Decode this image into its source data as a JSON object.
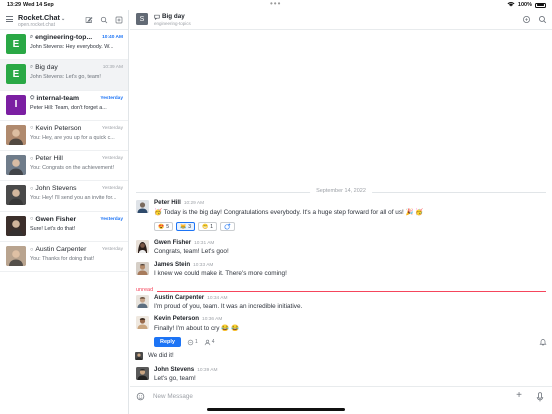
{
  "status_bar": {
    "time": "13:29",
    "date": "Wed 14 Sep",
    "battery": "100%"
  },
  "sidebar": {
    "workspace": "Rocket.Chat",
    "server": "open.rocket.chat",
    "rooms": [
      {
        "name": "engineering-top...",
        "time": "10:40 AM",
        "preview": "John Stevens: Hey everybody. W...",
        "avatar_letter": "E",
        "avatar_color": "#2aa845",
        "icon": "discussion-icon",
        "unread": true,
        "active": false
      },
      {
        "name": "Big day",
        "time": "10:39 AM",
        "preview": "John Stevens: Let's go, team!",
        "avatar_letter": "E",
        "avatar_color": "#2aa845",
        "icon": "discussion-icon",
        "unread": false,
        "active": true
      },
      {
        "name": "internal-team",
        "time": "Yesterday",
        "preview": "Peter Hill: Team, don't forget a...",
        "avatar_letter": "I",
        "avatar_color": "#7b1fa2",
        "icon": "team-icon",
        "unread": true,
        "active": false
      },
      {
        "name": "Kevin Peterson",
        "time": "Yesterday",
        "preview": "You: Hey, are you up for a quick c...",
        "avatar_color": "#b08a6e",
        "icon": "status-icon",
        "unread": false,
        "active": false
      },
      {
        "name": "Peter Hill",
        "time": "Yesterday",
        "preview": "You: Congrats on the achievement!",
        "avatar_color": "#6f7c8a",
        "icon": "status-icon",
        "unread": false,
        "active": false
      },
      {
        "name": "John Stevens",
        "time": "Yesterday",
        "preview": "You: Hey! I'll send you an invite for...",
        "avatar_color": "#4a4a4a",
        "icon": "status-icon",
        "unread": false,
        "active": false
      },
      {
        "name": "Gwen Fisher",
        "time": "Yesterday",
        "preview": "Sure! Let's do that!",
        "avatar_color": "#3c2f2b",
        "icon": "status-icon",
        "unread": true,
        "active": false
      },
      {
        "name": "Austin Carpenter",
        "time": "Yesterday",
        "preview": "You: Thanks for doing that!",
        "avatar_color": "#b9a48f",
        "icon": "status-icon",
        "unread": false,
        "active": false
      }
    ]
  },
  "header": {
    "title": "Big day",
    "subtitle": "engineering-topics",
    "avatar_letter": "S"
  },
  "messages": {
    "day_separator": "September 14, 2022",
    "unread_label": "unread",
    "items": [
      {
        "author": "Peter Hill",
        "time": "10:29 AM",
        "text": "🥳 Today is the big day! Congratulations everybody. It's a huge step forward for all of us! 🎉 🥳",
        "avatar_color": "#6f7c8a"
      },
      {
        "author": "Gwen Fisher",
        "time": "10:31 AM",
        "text": "Congrats, team! Let's goo!",
        "avatar_color": "#3c2f2b"
      },
      {
        "author": "James Stein",
        "time": "10:33 AM",
        "text": "I knew we could make it. There's more coming!",
        "avatar_color": "#a88566"
      },
      {
        "author": "Austin Carpenter",
        "time": "10:34 AM",
        "text": "I'm proud of you, team. It was an incredible initiative.",
        "avatar_color": "#b9a48f"
      },
      {
        "author": "Kevin Peterson",
        "time": "10:36 AM",
        "text": "Finally! I'm about to cry 😂 😂",
        "avatar_color": "#b08a6e"
      },
      {
        "author": "John Stevens",
        "time": "10:39 AM",
        "text": "Let's go, team!",
        "avatar_color": "#4a4a4a"
      }
    ],
    "reactions": [
      {
        "emoji": "😍",
        "count": "5",
        "mine": false
      },
      {
        "emoji": "😹",
        "count": "3",
        "mine": true
      },
      {
        "emoji": "😁",
        "count": "1",
        "mine": false
      }
    ],
    "thread": {
      "reply_label": "Reply",
      "replies": "1",
      "followers": "4",
      "last_reply": "We did it!"
    }
  },
  "composer": {
    "placeholder": "New Message"
  }
}
